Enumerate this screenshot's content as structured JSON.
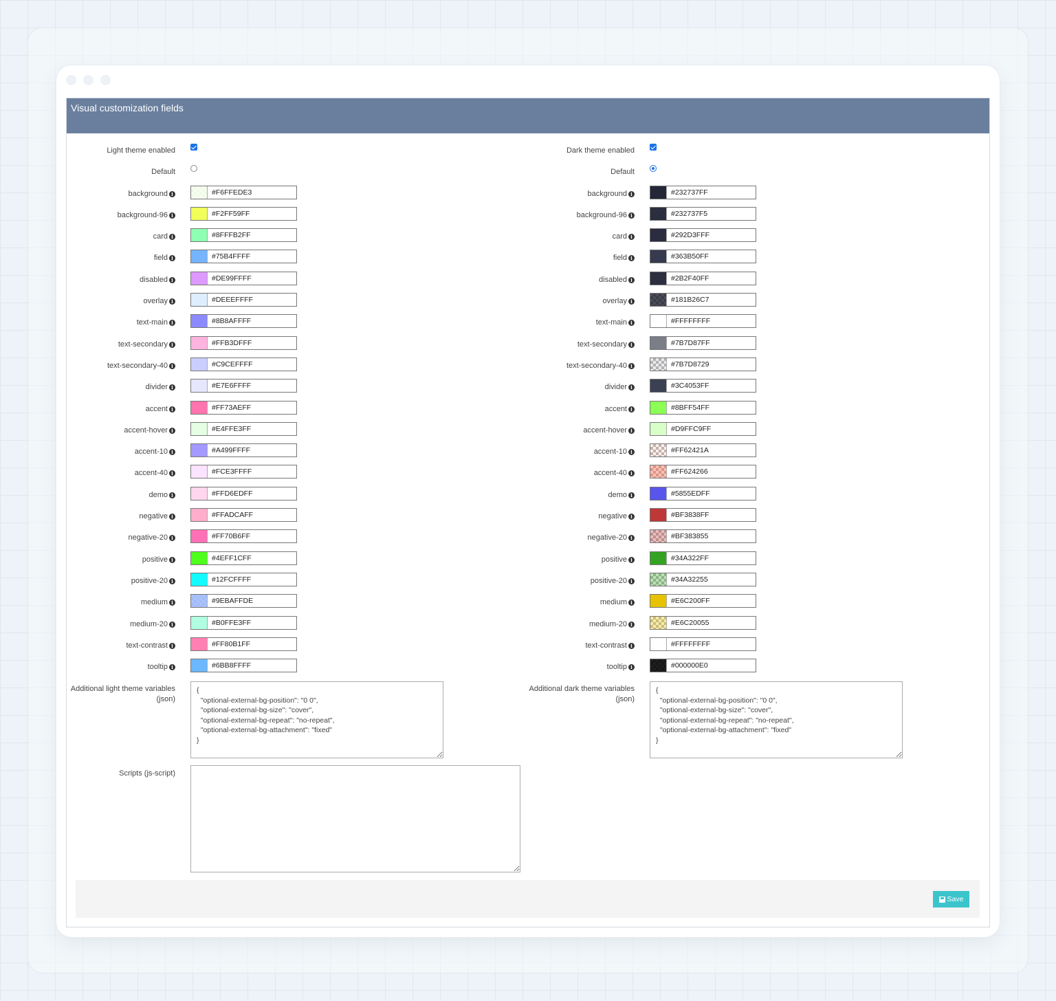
{
  "panel": {
    "title": "Visual customization fields"
  },
  "light": {
    "enabled_label": "Light theme enabled",
    "default_label": "Default",
    "default_selected": false,
    "colors": [
      {
        "name": "background",
        "hex": "#F6FFEDE3",
        "color": "#F6FFEDE3"
      },
      {
        "name": "background-96",
        "hex": "#F2FF59FF",
        "color": "#F2FF59FF"
      },
      {
        "name": "card",
        "hex": "#8FFFB2FF",
        "color": "#8FFFB2FF"
      },
      {
        "name": "field",
        "hex": "#75B4FFFF",
        "color": "#75B4FFFF"
      },
      {
        "name": "disabled",
        "hex": "#DE99FFFF",
        "color": "#DE99FFFF"
      },
      {
        "name": "overlay",
        "hex": "#DEEEFFFF",
        "color": "#DEEEFFFF"
      },
      {
        "name": "text-main",
        "hex": "#8B8AFFFF",
        "color": "#8B8AFFFF"
      },
      {
        "name": "text-secondary",
        "hex": "#FFB3DFFF",
        "color": "#FFB3DFFF"
      },
      {
        "name": "text-secondary-40",
        "hex": "#C9CEFFFF",
        "color": "#C9CEFFFF"
      },
      {
        "name": "divider",
        "hex": "#E7E6FFFF",
        "color": "#E7E6FFFF"
      },
      {
        "name": "accent",
        "hex": "#FF73AEFF",
        "color": "#FF73AEFF"
      },
      {
        "name": "accent-hover",
        "hex": "#E4FFE3FF",
        "color": "#E4FFE3FF"
      },
      {
        "name": "accent-10",
        "hex": "#A499FFFF",
        "color": "#A499FFFF"
      },
      {
        "name": "accent-40",
        "hex": "#FCE3FFFF",
        "color": "#FCE3FFFF"
      },
      {
        "name": "demo",
        "hex": "#FFD6EDFF",
        "color": "#FFD6EDFF"
      },
      {
        "name": "negative",
        "hex": "#FFADCAFF",
        "color": "#FFADCAFF"
      },
      {
        "name": "negative-20",
        "hex": "#FF70B6FF",
        "color": "#FF70B6FF"
      },
      {
        "name": "positive",
        "hex": "#4EFF1CFF",
        "color": "#4EFF1CFF"
      },
      {
        "name": "positive-20",
        "hex": "#12FCFFFF",
        "color": "#12FCFFFF"
      },
      {
        "name": "medium",
        "hex": "#9EBAFFDE",
        "color": "#9EBAFFDE"
      },
      {
        "name": "medium-20",
        "hex": "#B0FFE3FF",
        "color": "#B0FFE3FF"
      },
      {
        "name": "text-contrast",
        "hex": "#FF80B1FF",
        "color": "#FF80B1FF"
      },
      {
        "name": "tooltip",
        "hex": "#6BB8FFFF",
        "color": "#6BB8FFFF"
      }
    ],
    "json_label": "Additional light theme variables (json)",
    "json_value": "{\n  \"optional-external-bg-position\": \"0 0\",\n  \"optional-external-bg-size\": \"cover\",\n  \"optional-external-bg-repeat\": \"no-repeat\",\n  \"optional-external-bg-attachment\": \"fixed\"\n}"
  },
  "dark": {
    "enabled_label": "Dark theme enabled",
    "default_label": "Default",
    "default_selected": true,
    "colors": [
      {
        "name": "background",
        "hex": "#232737FF",
        "color": "#232737FF"
      },
      {
        "name": "background-96",
        "hex": "#232737F5",
        "color": "#232737F5"
      },
      {
        "name": "card",
        "hex": "#292D3FFF",
        "color": "#292D3FFF"
      },
      {
        "name": "field",
        "hex": "#363B50FF",
        "color": "#363B50FF"
      },
      {
        "name": "disabled",
        "hex": "#2B2F40FF",
        "color": "#2B2F40FF"
      },
      {
        "name": "overlay",
        "hex": "#181B26C7",
        "color": "#181B26C7"
      },
      {
        "name": "text-main",
        "hex": "#FFFFFFFF",
        "color": "#FFFFFFFF"
      },
      {
        "name": "text-secondary",
        "hex": "#7B7D87FF",
        "color": "#7B7D87FF"
      },
      {
        "name": "text-secondary-40",
        "hex": "#7B7D8729",
        "color": "#7B7D8729"
      },
      {
        "name": "divider",
        "hex": "#3C4053FF",
        "color": "#3C4053FF"
      },
      {
        "name": "accent",
        "hex": "#8BFF54FF",
        "color": "#8BFF54FF"
      },
      {
        "name": "accent-hover",
        "hex": "#D9FFC9FF",
        "color": "#D9FFC9FF"
      },
      {
        "name": "accent-10",
        "hex": "#FF62421A",
        "color": "#FF62421A"
      },
      {
        "name": "accent-40",
        "hex": "#FF624266",
        "color": "#FF624266"
      },
      {
        "name": "demo",
        "hex": "#5855EDFF",
        "color": "#5855EDFF"
      },
      {
        "name": "negative",
        "hex": "#BF3838FF",
        "color": "#BF3838FF"
      },
      {
        "name": "negative-20",
        "hex": "#BF383855",
        "color": "#BF383855"
      },
      {
        "name": "positive",
        "hex": "#34A322FF",
        "color": "#34A322FF"
      },
      {
        "name": "positive-20",
        "hex": "#34A32255",
        "color": "#34A32255"
      },
      {
        "name": "medium",
        "hex": "#E6C200FF",
        "color": "#E6C200FF"
      },
      {
        "name": "medium-20",
        "hex": "#E6C20055",
        "color": "#E6C20055"
      },
      {
        "name": "text-contrast",
        "hex": "#FFFFFFFF",
        "color": "#FFFFFFFF"
      },
      {
        "name": "tooltip",
        "hex": "#000000E0",
        "color": "#000000E0"
      }
    ],
    "json_label": "Additional dark theme variables (json)",
    "json_value": "{\n  \"optional-external-bg-position\": \"0 0\",\n  \"optional-external-bg-size\": \"cover\",\n  \"optional-external-bg-repeat\": \"no-repeat\",\n  \"optional-external-bg-attachment\": \"fixed\"\n}"
  },
  "scripts": {
    "label": "Scripts (js-script)",
    "value": ""
  },
  "footer": {
    "save_label": "Save",
    "save_icon": "floppy-disk-icon",
    "save_color": "#3CC4CC"
  },
  "colors": {
    "header_bg": "#6A7F9E",
    "checkbox_blue": "#1A73E8"
  }
}
